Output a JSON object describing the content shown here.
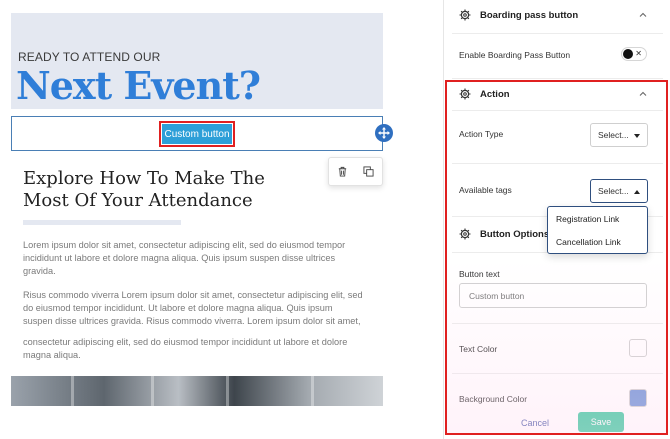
{
  "canvas": {
    "hero": {
      "kicker": "READY TO ATTEND OUR",
      "title": "Next Event?"
    },
    "button_block": {
      "label": "Custom button"
    },
    "toolbar_icons": [
      "trash-icon",
      "duplicate-icon"
    ],
    "section_heading": "Explore How To Make The Most Of Your Attendance",
    "paragraphs": [
      "Lorem ipsum dolor sit amet, consectetur adipiscing elit, sed do eiusmod tempor incididunt ut labore et dolore magna aliqua. Quis ipsum suspen disse ultrices gravida.",
      "Risus commodo viverra Lorem ipsum dolor sit amet, consectetur adipiscing elit, sed do eiusmod tempor incididunt. Ut labore et dolore magna aliqua. Quis ipsum suspen disse ultrices gravida. Risus commodo viverra. Lorem ipsum dolor sit amet,",
      "consectetur adipiscing elit, sed do eiusmod tempor incididunt ut labore et dolore magna aliqua."
    ]
  },
  "panel": {
    "boarding_pass": {
      "title": "Boarding pass button",
      "enable_label": "Enable Boarding Pass Button",
      "enabled": false
    },
    "action": {
      "title": "Action",
      "action_type_label": "Action Type",
      "action_type_value": "Select...",
      "available_tags_label": "Available tags",
      "available_tags_value": "Select...",
      "tag_options": [
        "Registration Link",
        "Cancellation Link"
      ]
    },
    "button_options": {
      "title": "Button Options",
      "button_text_label": "Button text",
      "button_text_placeholder": "Custom button",
      "text_color_label": "Text Color",
      "text_color_value": "#ffffff",
      "background_color_label": "Background Color",
      "background_color_value": "#6f93d6"
    },
    "footer": {
      "cancel_label": "Cancel",
      "save_label": "Save"
    }
  },
  "colors": {
    "accent_blue": "#2f7ed8",
    "button_blue": "#2d9fd8",
    "highlight_red": "#e02020",
    "save_green": "#3bc9a0"
  }
}
